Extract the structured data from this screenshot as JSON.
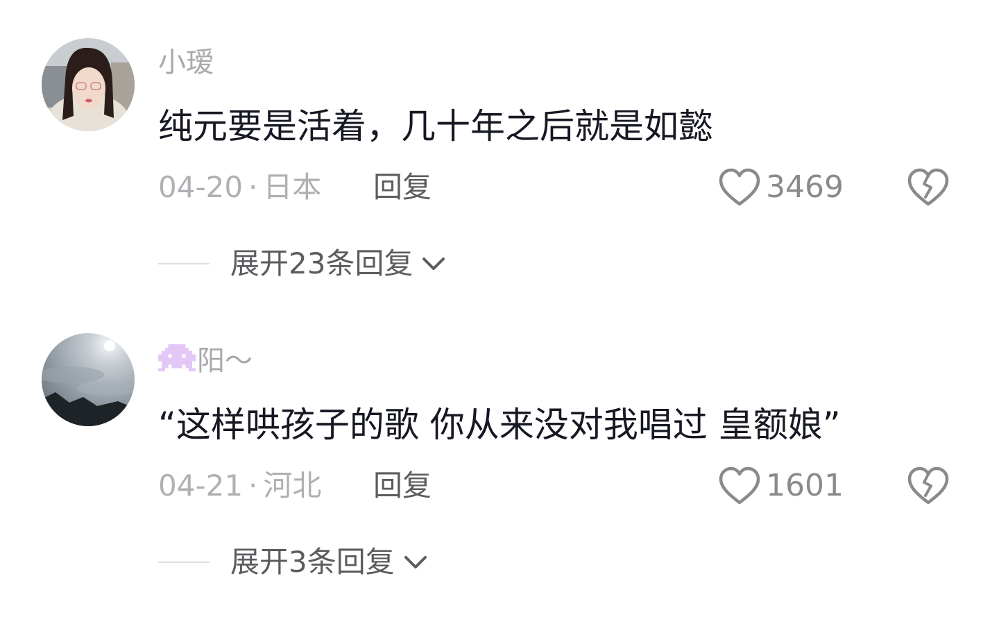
{
  "comments": [
    {
      "username": "小瑷",
      "text": "纯元要是活着，几十年之后就是如懿",
      "date": "04-20",
      "separator": "·",
      "location": "日本",
      "reply_label": "回复",
      "likes": "3469",
      "expand_label": "展开23条回复"
    },
    {
      "username": "阳～",
      "text": "“这样哄孩子的歌 你从来没对我唱过 皇额娘”",
      "date": "04-21",
      "separator": "·",
      "location": "河北",
      "reply_label": "回复",
      "likes": "1601",
      "expand_label": "展开3条回复"
    }
  ],
  "icons": {
    "like": "heart-outline-icon",
    "dislike": "broken-heart-icon",
    "expand": "chevron-down-icon",
    "badge": "pixel-invader-icon"
  },
  "colors": {
    "text_primary": "#161823",
    "text_secondary": "#a9a9ad",
    "action_text": "#5c5c60",
    "badge": "#e3c8f7"
  }
}
